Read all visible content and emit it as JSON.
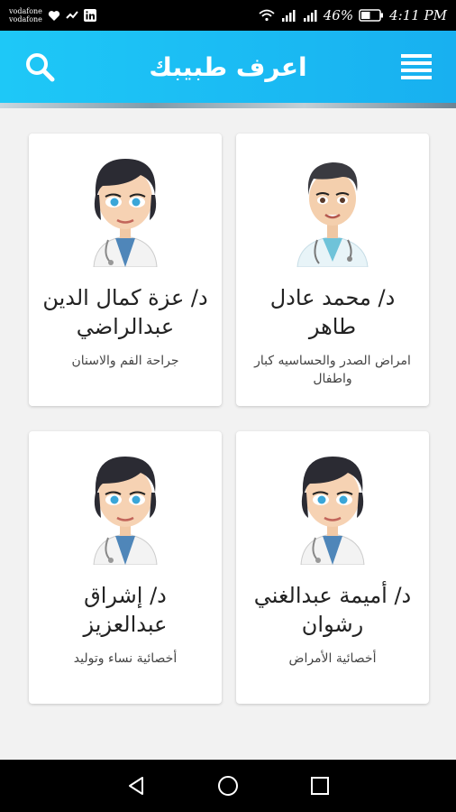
{
  "status_bar": {
    "carrier_1": "vodafone",
    "carrier_2": "vodafone",
    "battery": "46%",
    "time": "4:11 PM"
  },
  "app_bar": {
    "title": "اعرف طبيبك",
    "search_icon": "search-icon",
    "menu_icon": "menu-icon",
    "color": "#1ec8f7"
  },
  "doctors": [
    {
      "name": "د/ محمد عادل طاهر",
      "specialty": "امراض الصدر والحساسيه كبار واطفال",
      "avatar": "male-doctor"
    },
    {
      "name": "د/ عزة كمال الدين عبدالراضي",
      "specialty": "جراحة الفم والاسنان",
      "avatar": "female-doctor"
    },
    {
      "name": "د/ أميمة عبدالغني رشوان",
      "specialty": "أخصائية الأمراض",
      "avatar": "female-doctor"
    },
    {
      "name": "د/ إشراق عبدالعزيز",
      "specialty": "أخصائية نساء وتوليد",
      "avatar": "female-doctor"
    }
  ],
  "nav_bar": {
    "back_icon": "back-icon",
    "home_icon": "home-icon",
    "recents_icon": "recents-icon"
  }
}
